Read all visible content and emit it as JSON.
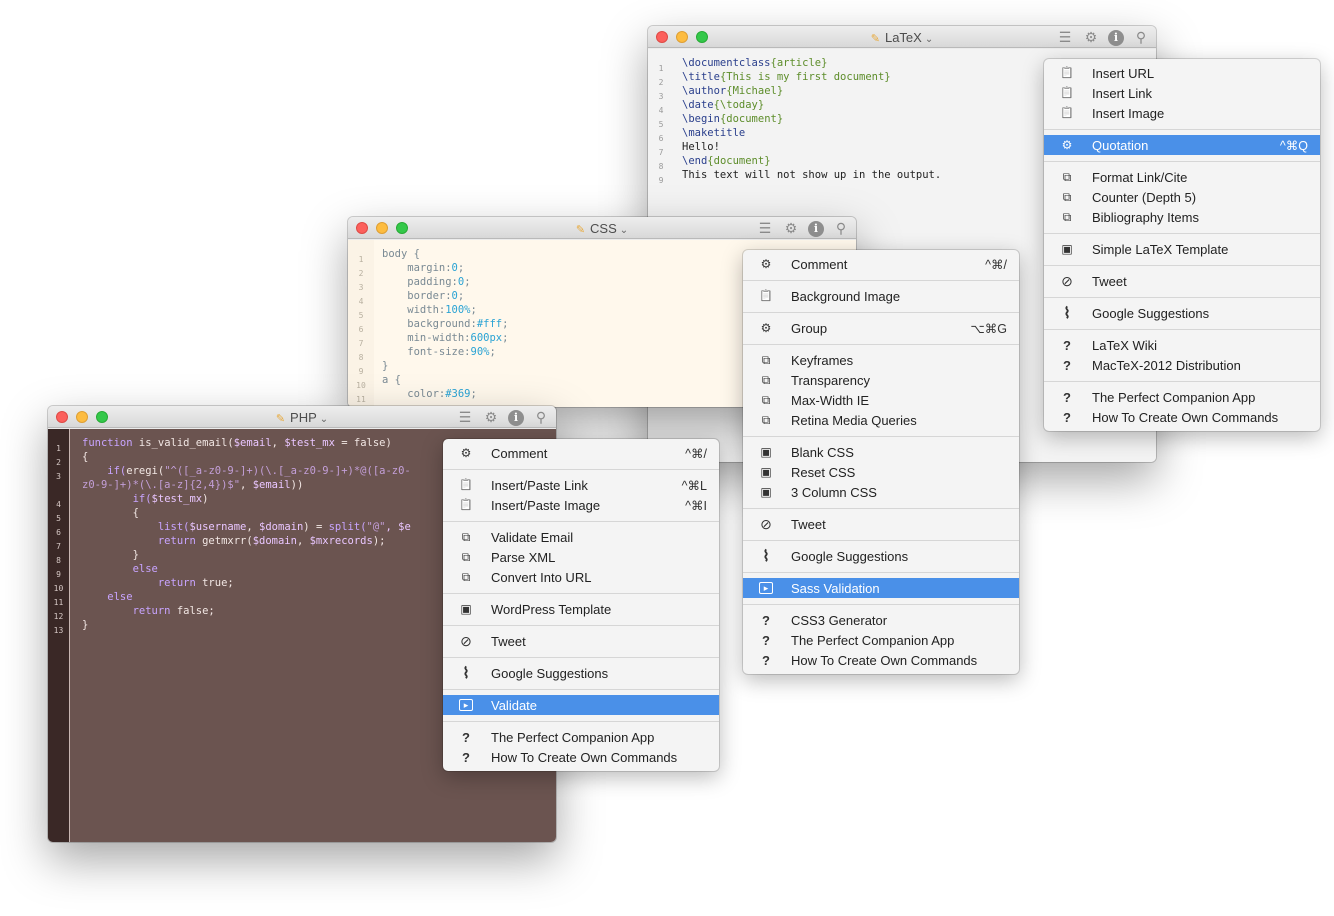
{
  "windows": {
    "latex": {
      "title": "LaTeX",
      "line_numbers": [
        "1",
        "2",
        "3",
        "4",
        "5",
        "6",
        "7",
        "8",
        "9"
      ],
      "lines": [
        [
          {
            "t": "\\documentclass",
            "c": "cmd"
          },
          {
            "t": "{article}",
            "c": "arg"
          }
        ],
        [
          {
            "t": "\\title",
            "c": "cmd"
          },
          {
            "t": "{This is my first document}",
            "c": "arg"
          }
        ],
        [
          {
            "t": "\\author",
            "c": "cmd"
          },
          {
            "t": "{Michael}",
            "c": "arg"
          }
        ],
        [
          {
            "t": "\\date",
            "c": "cmd"
          },
          {
            "t": "{\\today}",
            "c": "arg"
          }
        ],
        [
          {
            "t": "\\begin",
            "c": "cmd"
          },
          {
            "t": "{document}",
            "c": "arg"
          }
        ],
        [
          {
            "t": "\\maketitle",
            "c": "cmd"
          }
        ],
        [
          {
            "t": "Hello!",
            "c": ""
          }
        ],
        [
          {
            "t": "\\end",
            "c": "cmd"
          },
          {
            "t": "{document}",
            "c": "arg"
          }
        ],
        [
          {
            "t": "This text will not show up in the output.",
            "c": ""
          }
        ]
      ]
    },
    "css": {
      "title": "CSS",
      "line_numbers": [
        "1",
        "2",
        "3",
        "4",
        "5",
        "6",
        "7",
        "8",
        "9",
        "10",
        "11"
      ],
      "lines": [
        [
          {
            "t": "body {",
            "c": ""
          }
        ],
        [
          {
            "t": "    margin:",
            "c": ""
          },
          {
            "t": "0",
            "c": "val"
          },
          {
            "t": ";",
            "c": ""
          }
        ],
        [
          {
            "t": "    padding:",
            "c": ""
          },
          {
            "t": "0",
            "c": "val"
          },
          {
            "t": ";",
            "c": ""
          }
        ],
        [
          {
            "t": "    border:",
            "c": ""
          },
          {
            "t": "0",
            "c": "val"
          },
          {
            "t": ";",
            "c": ""
          }
        ],
        [
          {
            "t": "    width:",
            "c": ""
          },
          {
            "t": "100%",
            "c": "val"
          },
          {
            "t": ";",
            "c": ""
          }
        ],
        [
          {
            "t": "    background:",
            "c": ""
          },
          {
            "t": "#fff",
            "c": "val"
          },
          {
            "t": ";",
            "c": ""
          }
        ],
        [
          {
            "t": "    min-width:",
            "c": ""
          },
          {
            "t": "600px",
            "c": "val"
          },
          {
            "t": ";",
            "c": ""
          }
        ],
        [
          {
            "t": "    font-size:",
            "c": ""
          },
          {
            "t": "90%",
            "c": "val"
          },
          {
            "t": ";",
            "c": ""
          }
        ],
        [
          {
            "t": "}",
            "c": ""
          }
        ],
        [
          {
            "t": "a {",
            "c": ""
          }
        ],
        [
          {
            "t": "    color:",
            "c": ""
          },
          {
            "t": "#369",
            "c": "val"
          },
          {
            "t": ";",
            "c": ""
          }
        ]
      ]
    },
    "php": {
      "title": "PHP",
      "line_numbers": [
        "1",
        "2",
        "3",
        "",
        "4",
        "5",
        "6",
        "7",
        "8",
        "9",
        "10",
        "11",
        "12",
        "13"
      ],
      "lines": [
        [
          {
            "t": "function ",
            "c": "kw"
          },
          {
            "t": "is_valid_email(",
            "c": ""
          },
          {
            "t": "$email",
            "c": "var"
          },
          {
            "t": ", ",
            "c": ""
          },
          {
            "t": "$test_mx",
            "c": "var"
          },
          {
            "t": " = false)",
            "c": ""
          }
        ],
        [
          {
            "t": "{",
            "c": ""
          }
        ],
        [
          {
            "t": "    if(",
            "c": "kw"
          },
          {
            "t": "eregi(",
            "c": ""
          },
          {
            "t": "\"^([_a-z0-9-]+)(\\.[_a-z0-9-]+)*@([a-z0-",
            "c": "str"
          }
        ],
        [
          {
            "t": "z0-9-]+)*(\\.[a-z]{2,4})$\"",
            "c": "str"
          },
          {
            "t": ", ",
            "c": ""
          },
          {
            "t": "$email",
            "c": "var"
          },
          {
            "t": "))",
            "c": ""
          }
        ],
        [
          {
            "t": "        if(",
            "c": "kw"
          },
          {
            "t": "$test_mx",
            "c": "var"
          },
          {
            "t": ")",
            "c": ""
          }
        ],
        [
          {
            "t": "        {",
            "c": ""
          }
        ],
        [
          {
            "t": "            list(",
            "c": "kw"
          },
          {
            "t": "$username",
            "c": "var"
          },
          {
            "t": ", ",
            "c": ""
          },
          {
            "t": "$domain",
            "c": "var"
          },
          {
            "t": ") = ",
            "c": ""
          },
          {
            "t": "split(",
            "c": "kw"
          },
          {
            "t": "\"@\"",
            "c": "str"
          },
          {
            "t": ", $e",
            "c": "var"
          }
        ],
        [
          {
            "t": "            return ",
            "c": "kw"
          },
          {
            "t": "getmxrr(",
            "c": ""
          },
          {
            "t": "$domain",
            "c": "var"
          },
          {
            "t": ", ",
            "c": ""
          },
          {
            "t": "$mxrecords",
            "c": "var"
          },
          {
            "t": ");",
            "c": ""
          }
        ],
        [
          {
            "t": "        }",
            "c": ""
          }
        ],
        [
          {
            "t": "        else",
            "c": "kw"
          }
        ],
        [
          {
            "t": "            return ",
            "c": "kw"
          },
          {
            "t": "true;",
            "c": ""
          }
        ],
        [
          {
            "t": "    else",
            "c": "kw"
          }
        ],
        [
          {
            "t": "        return ",
            "c": "kw"
          },
          {
            "t": "false;",
            "c": ""
          }
        ],
        [
          {
            "t": "}",
            "c": ""
          }
        ]
      ]
    }
  },
  "menus": {
    "latex": [
      {
        "label": "Insert URL",
        "icon": "clipboard-icon"
      },
      {
        "label": "Insert Link",
        "icon": "clipboard-icon"
      },
      {
        "label": "Insert Image",
        "icon": "clipboard-icon"
      },
      {
        "sep": true
      },
      {
        "label": "Quotation",
        "icon": "gears-icon",
        "shortcut": "^⌘Q",
        "selected": true
      },
      {
        "sep": true
      },
      {
        "label": "Format Link/Cite",
        "icon": "puzzle-icon"
      },
      {
        "label": "Counter (Depth 5)",
        "icon": "puzzle-icon"
      },
      {
        "label": "Bibliography Items",
        "icon": "puzzle-icon"
      },
      {
        "sep": true
      },
      {
        "label": "Simple LaTeX Template",
        "icon": "template-icon"
      },
      {
        "sep": true
      },
      {
        "label": "Tweet",
        "icon": "compass-icon"
      },
      {
        "sep": true
      },
      {
        "label": "Google Suggestions",
        "icon": "paperclip-icon"
      },
      {
        "sep": true
      },
      {
        "label": "LaTeX Wiki",
        "icon": "question-icon"
      },
      {
        "label": "MacTeX-2012 Distribution",
        "icon": "question-icon"
      },
      {
        "sep": true
      },
      {
        "label": "The Perfect Companion App",
        "icon": "question-icon"
      },
      {
        "label": "How To Create Own Commands",
        "icon": "question-icon"
      }
    ],
    "css": [
      {
        "label": "Comment",
        "icon": "gears-icon",
        "shortcut": "^⌘/"
      },
      {
        "sep": true
      },
      {
        "label": "Background Image",
        "icon": "clipboard-icon"
      },
      {
        "sep": true
      },
      {
        "label": "Group",
        "icon": "gears-icon",
        "shortcut": "⌥⌘G"
      },
      {
        "sep": true
      },
      {
        "label": "Keyframes",
        "icon": "puzzle-icon"
      },
      {
        "label": "Transparency",
        "icon": "puzzle-icon"
      },
      {
        "label": "Max-Width IE",
        "icon": "puzzle-icon"
      },
      {
        "label": "Retina Media Queries",
        "icon": "puzzle-icon"
      },
      {
        "sep": true
      },
      {
        "label": "Blank CSS",
        "icon": "template-icon"
      },
      {
        "label": "Reset CSS",
        "icon": "template-icon"
      },
      {
        "label": "3 Column CSS",
        "icon": "template-icon"
      },
      {
        "sep": true
      },
      {
        "label": "Tweet",
        "icon": "compass-icon"
      },
      {
        "sep": true
      },
      {
        "label": "Google Suggestions",
        "icon": "paperclip-icon"
      },
      {
        "sep": true
      },
      {
        "label": "Sass Validation",
        "icon": "terminal-icon",
        "selected": true
      },
      {
        "sep": true
      },
      {
        "label": "CSS3 Generator",
        "icon": "question-icon"
      },
      {
        "label": "The Perfect Companion App",
        "icon": "question-icon"
      },
      {
        "label": "How To Create Own Commands",
        "icon": "question-icon"
      }
    ],
    "php": [
      {
        "label": "Comment",
        "icon": "gears-icon",
        "shortcut": "^⌘/"
      },
      {
        "sep": true
      },
      {
        "label": "Insert/Paste Link",
        "icon": "clipboard-icon",
        "shortcut": "^⌘L"
      },
      {
        "label": "Insert/Paste Image",
        "icon": "clipboard-icon",
        "shortcut": "^⌘I"
      },
      {
        "sep": true
      },
      {
        "label": "Validate Email",
        "icon": "puzzle-icon"
      },
      {
        "label": "Parse XML",
        "icon": "puzzle-icon"
      },
      {
        "label": "Convert Into URL",
        "icon": "puzzle-icon"
      },
      {
        "sep": true
      },
      {
        "label": "WordPress Template",
        "icon": "template-icon"
      },
      {
        "sep": true
      },
      {
        "label": "Tweet",
        "icon": "compass-icon"
      },
      {
        "sep": true
      },
      {
        "label": "Google Suggestions",
        "icon": "paperclip-icon"
      },
      {
        "sep": true
      },
      {
        "label": "Validate",
        "icon": "terminal-icon",
        "selected": true
      },
      {
        "sep": true
      },
      {
        "label": "The Perfect Companion App",
        "icon": "question-icon"
      },
      {
        "label": "How To Create Own Commands",
        "icon": "question-icon"
      }
    ]
  },
  "colors": {
    "accent": "#4a90e8",
    "php_background": "#6b5450",
    "css_background": "#fff8ec",
    "latex_background": "#f3f3f3"
  }
}
